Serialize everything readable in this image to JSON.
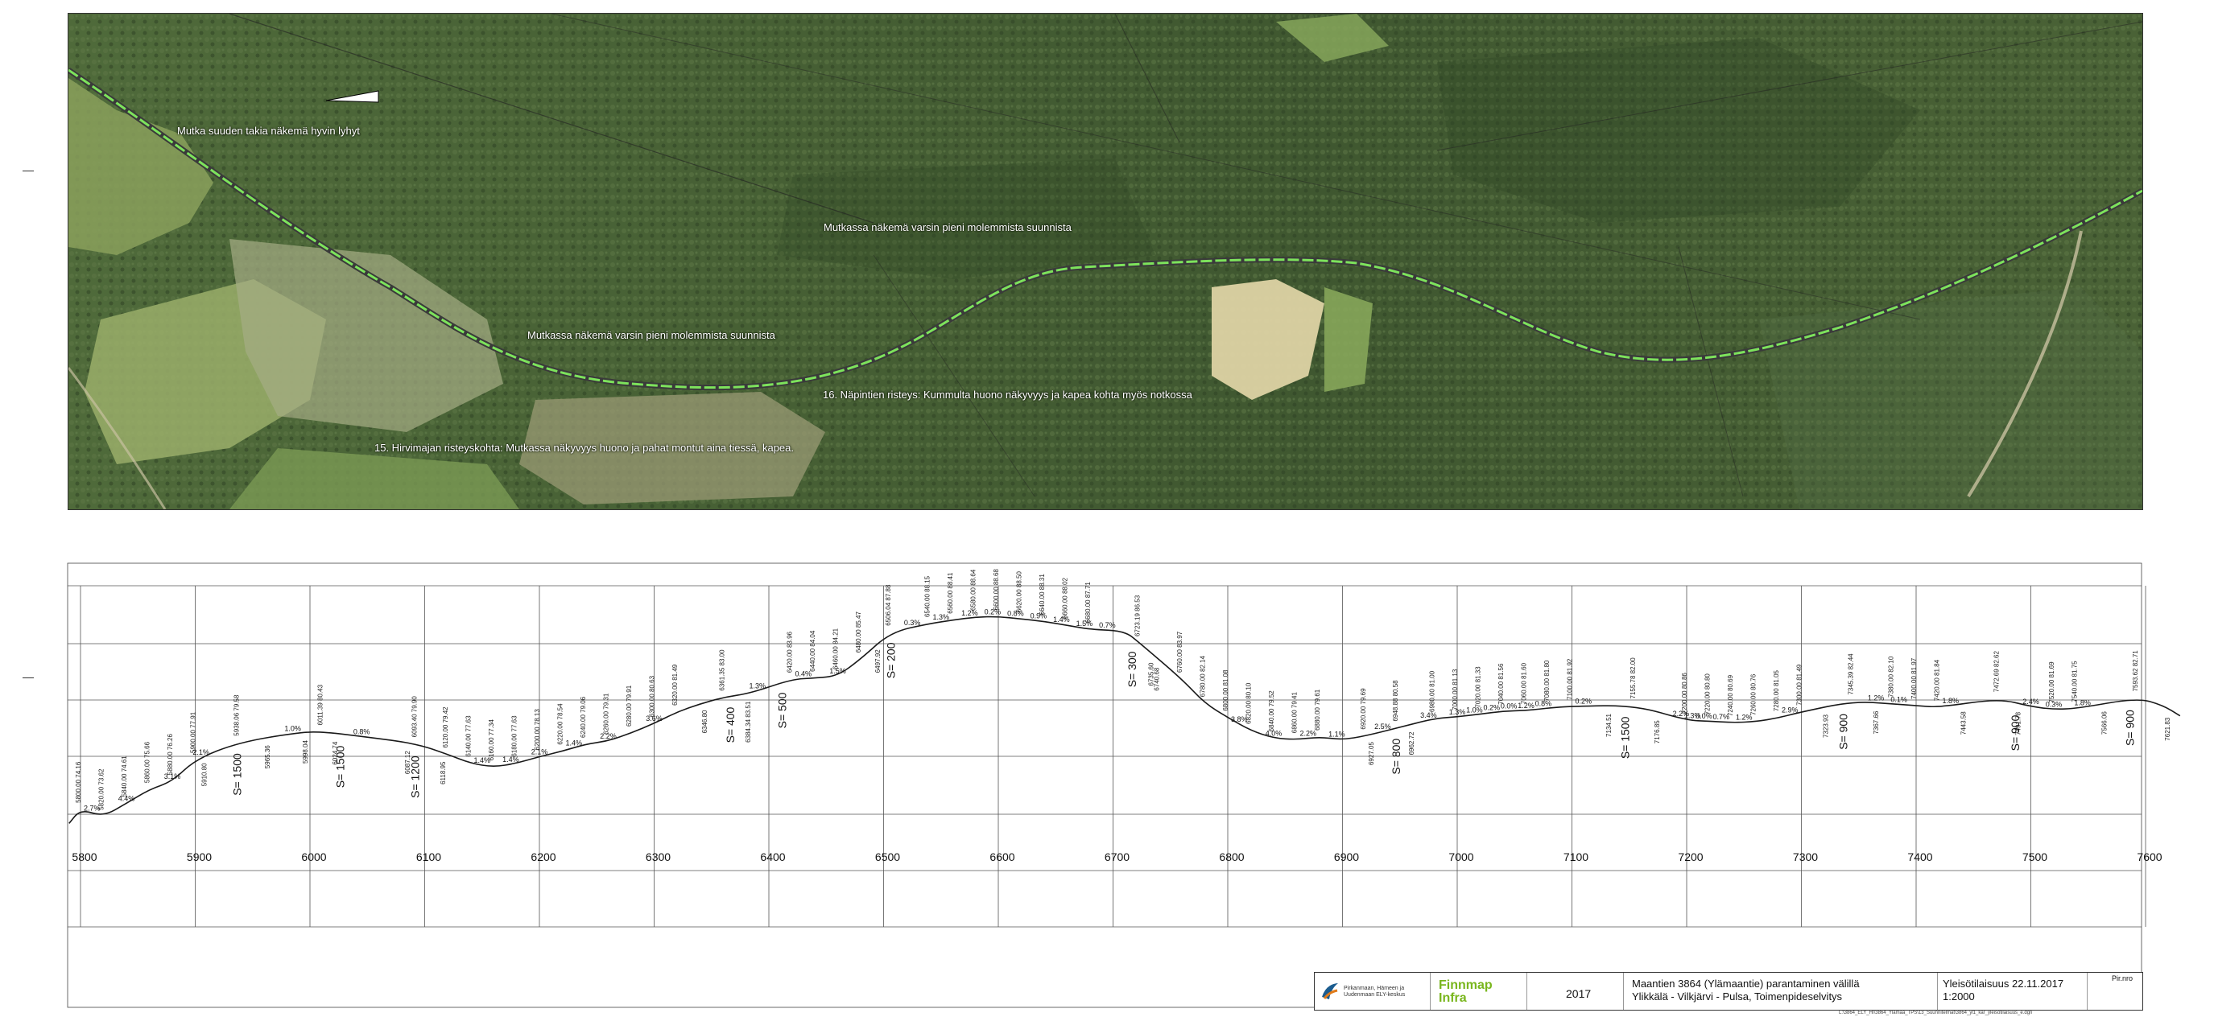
{
  "aerial": {
    "annotations": [
      {
        "id": "a1",
        "text": "Mutka suuden takia näkemä hyvin lyhyt"
      },
      {
        "id": "a2",
        "text": "Mutkassa näkemä varsin pieni molemmista suunnista"
      },
      {
        "id": "a3",
        "text": "Mutkassa näkemä varsin pieni molemmista suunnista"
      },
      {
        "id": "a4",
        "text": "16. Näpintien risteys: Kummulta huono näkyvyys ja kapea kohta myös notkossa"
      },
      {
        "id": "a5",
        "text": "15. Hirvimajan risteyskohta: Mutkassa näkyvyys huono ja pahat montut aina tiessä, kapea."
      }
    ]
  },
  "profile": {
    "stations": [
      "5800",
      "5900",
      "6000",
      "6100",
      "6200",
      "6300",
      "6400",
      "6500",
      "6600",
      "6700",
      "6800",
      "6900",
      "7000",
      "7100",
      "7200",
      "7300",
      "7400",
      "7500",
      "7600"
    ],
    "curve_labels": [
      {
        "text": "S= 1500",
        "km": 5940
      },
      {
        "text": "S= 1500",
        "km": 6030
      },
      {
        "text": "S= 1200",
        "km": 6095
      },
      {
        "text": "S= 400",
        "km": 6370
      },
      {
        "text": "S= 500",
        "km": 6415
      },
      {
        "text": "S= 200",
        "km": 6510
      },
      {
        "text": "S= 300",
        "km": 6720
      },
      {
        "text": "S= 800",
        "km": 6950
      },
      {
        "text": "S= 1500",
        "km": 7150
      },
      {
        "text": "S= 900",
        "km": 7340
      },
      {
        "text": "S= 900",
        "km": 7490
      },
      {
        "text": "S= 900",
        "km": 7590
      }
    ],
    "grades": [
      {
        "text": "2.7%",
        "km": 5810
      },
      {
        "text": "4.4%",
        "km": 5840
      },
      {
        "text": "3.1%",
        "km": 5880
      },
      {
        "text": "2.1%",
        "km": 5905
      },
      {
        "text": "1.0%",
        "km": 5985
      },
      {
        "text": "0.8%",
        "km": 6045
      },
      {
        "text": "1.4%",
        "km": 6150
      },
      {
        "text": "1.4%",
        "km": 6175
      },
      {
        "text": "2.1%",
        "km": 6200
      },
      {
        "text": "1.4%",
        "km": 6230
      },
      {
        "text": "2.2%",
        "km": 6260
      },
      {
        "text": "3.6%",
        "km": 6300
      },
      {
        "text": "1.3%",
        "km": 6390
      },
      {
        "text": "0.4%",
        "km": 6430
      },
      {
        "text": "1.5%",
        "km": 6460
      },
      {
        "text": "0.3%",
        "km": 6525
      },
      {
        "text": "1.3%",
        "km": 6550
      },
      {
        "text": "1.2%",
        "km": 6575
      },
      {
        "text": "0.2%",
        "km": 6595
      },
      {
        "text": "0.8%",
        "km": 6615
      },
      {
        "text": "0.9%",
        "km": 6635
      },
      {
        "text": "1.4%",
        "km": 6655
      },
      {
        "text": "1.5%",
        "km": 6675
      },
      {
        "text": "0.7%",
        "km": 6695
      },
      {
        "text": "3.8%",
        "km": 6810
      },
      {
        "text": "4.0%",
        "km": 6840
      },
      {
        "text": "2.2%",
        "km": 6870
      },
      {
        "text": "1.1%",
        "km": 6895
      },
      {
        "text": "2.5%",
        "km": 6935
      },
      {
        "text": "3.4%",
        "km": 6975
      },
      {
        "text": "1.3%",
        "km": 7000
      },
      {
        "text": "1.0%",
        "km": 7015
      },
      {
        "text": "0.2%",
        "km": 7030
      },
      {
        "text": "0.0%",
        "km": 7045
      },
      {
        "text": "1.2%",
        "km": 7060
      },
      {
        "text": "0.8%",
        "km": 7075
      },
      {
        "text": "0.2%",
        "km": 7110
      },
      {
        "text": "2.2%",
        "km": 7195
      },
      {
        "text": "1.3%",
        "km": 7205
      },
      {
        "text": "0.0%",
        "km": 7215
      },
      {
        "text": "0.7%",
        "km": 7230
      },
      {
        "text": "1.2%",
        "km": 7250
      },
      {
        "text": "2.9%",
        "km": 7290
      },
      {
        "text": "1.2%",
        "km": 7365
      },
      {
        "text": "0.1%",
        "km": 7385
      },
      {
        "text": "1.8%",
        "km": 7430
      },
      {
        "text": "2.4%",
        "km": 7500
      },
      {
        "text": "0.3%",
        "km": 7520
      },
      {
        "text": "1.8%",
        "km": 7545
      }
    ],
    "elevations": [
      {
        "text": "5800.00 74.16",
        "km": 5800
      },
      {
        "text": "5820.00 73.62",
        "km": 5820
      },
      {
        "text": "5840.00 74.61",
        "km": 5840
      },
      {
        "text": "5860.00 75.66",
        "km": 5860
      },
      {
        "text": "5880.00 76.26",
        "km": 5880
      },
      {
        "text": "5900.00 77.91",
        "km": 5900
      },
      {
        "text": "5938.06 79.58",
        "km": 5938
      },
      {
        "text": "6011.39 80.43",
        "km": 6011
      },
      {
        "text": "6093.40 79.90",
        "km": 6093
      },
      {
        "text": "6120.00 79.42",
        "km": 6120
      },
      {
        "text": "6140.00 77.63",
        "km": 6140
      },
      {
        "text": "6160.00 77.34",
        "km": 6160
      },
      {
        "text": "6180.00 77.63",
        "km": 6180
      },
      {
        "text": "6200.00 78.13",
        "km": 6200
      },
      {
        "text": "6220.00 78.54",
        "km": 6220
      },
      {
        "text": "6240.00 79.06",
        "km": 6240
      },
      {
        "text": "6260.00 79.31",
        "km": 6260
      },
      {
        "text": "6280.00 79.91",
        "km": 6280
      },
      {
        "text": "6300.00 80.63",
        "km": 6300
      },
      {
        "text": "6320.00 81.49",
        "km": 6320
      },
      {
        "text": "6361.35 83.00",
        "km": 6361
      },
      {
        "text": "6420.00 83.96",
        "km": 6420
      },
      {
        "text": "6440.00 84.04",
        "km": 6440
      },
      {
        "text": "6460.00 84.21",
        "km": 6460
      },
      {
        "text": "6480.00 85.47",
        "km": 6480
      },
      {
        "text": "6506.04 87.88",
        "km": 6506
      },
      {
        "text": "6540.00 88.15",
        "km": 6540
      },
      {
        "text": "6560.00 88.41",
        "km": 6560
      },
      {
        "text": "6580.00 88.64",
        "km": 6580
      },
      {
        "text": "6600.00 88.68",
        "km": 6600
      },
      {
        "text": "6620.00 88.50",
        "km": 6620
      },
      {
        "text": "6640.00 88.31",
        "km": 6640
      },
      {
        "text": "6660.00 88.02",
        "km": 6660
      },
      {
        "text": "6680.00 87.71",
        "km": 6680
      },
      {
        "text": "6723.19 86.53",
        "km": 6723
      },
      {
        "text": "6760.00 83.97",
        "km": 6760
      },
      {
        "text": "6780.00 82.14",
        "km": 6780
      },
      {
        "text": "6800.00 81.08",
        "km": 6800
      },
      {
        "text": "6820.00 80.10",
        "km": 6820
      },
      {
        "text": "6840.00 79.52",
        "km": 6840
      },
      {
        "text": "6860.00 79.41",
        "km": 6860
      },
      {
        "text": "6880.00 79.61",
        "km": 6880
      },
      {
        "text": "6920.00 79.69",
        "km": 6920
      },
      {
        "text": "6948.88 80.58",
        "km": 6948
      },
      {
        "text": "6980.00 81.00",
        "km": 6980
      },
      {
        "text": "7000.00 81.13",
        "km": 7000
      },
      {
        "text": "7020.00 81.33",
        "km": 7020
      },
      {
        "text": "7040.00 81.56",
        "km": 7040
      },
      {
        "text": "7060.00 81.60",
        "km": 7060
      },
      {
        "text": "7080.00 81.80",
        "km": 7080
      },
      {
        "text": "7100.00 81.92",
        "km": 7100
      },
      {
        "text": "7155.78 82.00",
        "km": 7155
      },
      {
        "text": "7200.00 80.86",
        "km": 7200
      },
      {
        "text": "7220.00 80.80",
        "km": 7220
      },
      {
        "text": "7240.00 80.69",
        "km": 7240
      },
      {
        "text": "7260.00 80.76",
        "km": 7260
      },
      {
        "text": "7280.00 81.05",
        "km": 7280
      },
      {
        "text": "7300.00 81.49",
        "km": 7300
      },
      {
        "text": "7345.39 82.44",
        "km": 7345
      },
      {
        "text": "7380.00 82.10",
        "km": 7380
      },
      {
        "text": "7400.00 81.97",
        "km": 7400
      },
      {
        "text": "7420.00 81.84",
        "km": 7420
      },
      {
        "text": "7472.69 82.62",
        "km": 7472
      },
      {
        "text": "7520.00 81.69",
        "km": 7520
      },
      {
        "text": "7540.00 81.75",
        "km": 7540
      },
      {
        "text": "7593.62 82.71",
        "km": 7593
      }
    ],
    "below_labels": [
      {
        "text": "5910.80",
        "km": 5910
      },
      {
        "text": "5965.36",
        "km": 5965
      },
      {
        "text": "5998.04",
        "km": 5998
      },
      {
        "text": "6024.74",
        "km": 6024
      },
      {
        "text": "6087.12",
        "km": 6087
      },
      {
        "text": "6118.95",
        "km": 6118
      },
      {
        "text": "6346.80",
        "km": 6346
      },
      {
        "text": "6384.34 83.51",
        "km": 6384
      },
      {
        "text": "6497.92",
        "km": 6497
      },
      {
        "text": "6735.60",
        "km": 6735
      },
      {
        "text": "6740.68",
        "km": 6740
      },
      {
        "text": "6927.05",
        "km": 6927
      },
      {
        "text": "6962.72",
        "km": 6962
      },
      {
        "text": "7134.51",
        "km": 7134
      },
      {
        "text": "7176.85",
        "km": 7176
      },
      {
        "text": "7323.93",
        "km": 7323
      },
      {
        "text": "7367.66",
        "km": 7367
      },
      {
        "text": "7443.58",
        "km": 7443
      },
      {
        "text": "7491.78",
        "km": 7491
      },
      {
        "text": "7566.06",
        "km": 7566
      },
      {
        "text": "7621.83",
        "km": 7621
      }
    ],
    "profile_points": [
      [
        5790,
        73.1
      ],
      [
        5800,
        74.16
      ],
      [
        5820,
        73.62
      ],
      [
        5840,
        74.61
      ],
      [
        5860,
        75.66
      ],
      [
        5880,
        76.26
      ],
      [
        5900,
        77.91
      ],
      [
        5938,
        79.2
      ],
      [
        5990,
        79.95
      ],
      [
        6011,
        80.0
      ],
      [
        6050,
        79.6
      ],
      [
        6093,
        79.1
      ],
      [
        6120,
        78.3
      ],
      [
        6140,
        77.63
      ],
      [
        6160,
        77.34
      ],
      [
        6180,
        77.63
      ],
      [
        6200,
        78.13
      ],
      [
        6220,
        78.54
      ],
      [
        6240,
        79.06
      ],
      [
        6260,
        79.31
      ],
      [
        6280,
        79.91
      ],
      [
        6300,
        80.63
      ],
      [
        6320,
        81.49
      ],
      [
        6340,
        82.1
      ],
      [
        6361,
        82.6
      ],
      [
        6384,
        82.9
      ],
      [
        6420,
        83.96
      ],
      [
        6440,
        84.04
      ],
      [
        6460,
        84.21
      ],
      [
        6480,
        85.47
      ],
      [
        6506,
        87.5
      ],
      [
        6540,
        88.15
      ],
      [
        6560,
        88.41
      ],
      [
        6580,
        88.64
      ],
      [
        6600,
        88.68
      ],
      [
        6620,
        88.5
      ],
      [
        6640,
        88.31
      ],
      [
        6660,
        88.02
      ],
      [
        6680,
        87.71
      ],
      [
        6710,
        87.6
      ],
      [
        6723,
        86.7
      ],
      [
        6760,
        83.97
      ],
      [
        6780,
        82.14
      ],
      [
        6800,
        81.08
      ],
      [
        6820,
        80.1
      ],
      [
        6840,
        79.52
      ],
      [
        6860,
        79.41
      ],
      [
        6880,
        79.61
      ],
      [
        6900,
        79.4
      ],
      [
        6920,
        79.69
      ],
      [
        6948,
        80.3
      ],
      [
        6980,
        81.0
      ],
      [
        7000,
        81.13
      ],
      [
        7020,
        81.33
      ],
      [
        7040,
        81.56
      ],
      [
        7060,
        81.6
      ],
      [
        7080,
        81.8
      ],
      [
        7100,
        81.92
      ],
      [
        7155,
        82.0
      ],
      [
        7200,
        80.86
      ],
      [
        7220,
        80.8
      ],
      [
        7240,
        80.69
      ],
      [
        7260,
        80.76
      ],
      [
        7280,
        81.05
      ],
      [
        7300,
        81.49
      ],
      [
        7345,
        82.3
      ],
      [
        7380,
        82.1
      ],
      [
        7400,
        81.97
      ],
      [
        7420,
        81.84
      ],
      [
        7472,
        82.5
      ],
      [
        7500,
        81.9
      ],
      [
        7520,
        81.69
      ],
      [
        7540,
        81.75
      ],
      [
        7593,
        82.55
      ],
      [
        7615,
        82.0
      ],
      [
        7630,
        81.2
      ]
    ]
  },
  "titleblock": {
    "org": "Pirkanmaan, Hämeen ja Uudenmaan ELY-keskus",
    "finnmap_line1": "Finnmap",
    "finnmap_line2": "Infra",
    "year": "2017",
    "title_line1": "Maantien 3864 (Ylämaantie) parantaminen välillä",
    "title_line2": "Ylikkälä - Vilkjärvi - Pulsa, Toimenpideselvitys",
    "plan_line1": "Yleisötilaisuus 22.11.2017",
    "plan_line2": "1:2000",
    "pir_label": "Pir.nro",
    "filepath": "L:\\3864_ELY_HI\\3864_Ylämaa_TPS\\13_Suunnitelmat\\3864_yl1_kar_yleisotilaisuus_e.dgn"
  },
  "colors": {
    "road_highlight": "#7de35c",
    "profile_line": "#1a1a1a",
    "grid_line": "#555555"
  }
}
